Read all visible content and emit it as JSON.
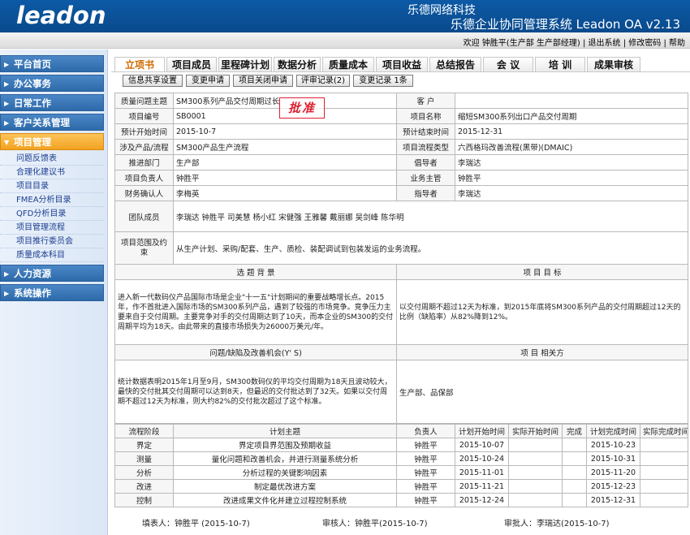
{
  "header": {
    "logo": "leadon",
    "company": "乐德网络科技",
    "system_title": "乐德企业协同管理系统 Leadon OA v2.13"
  },
  "userbar": {
    "welcome": "欢迎 钟胜平(生产部 生产部经理)",
    "logout": "退出系统",
    "change_password": "修改密码",
    "help": "帮助"
  },
  "sidebar": {
    "items": [
      {
        "label": "平台首页"
      },
      {
        "label": "办公事务"
      },
      {
        "label": "日常工作"
      },
      {
        "label": "客户关系管理"
      },
      {
        "label": "项目管理"
      },
      {
        "label": "人力资源"
      },
      {
        "label": "系统操作"
      }
    ],
    "subitems": [
      "问题反馈表",
      "合理化建议书",
      "项目目录",
      "FMEA分析目录",
      "QFD分析目录",
      "项目管理流程",
      "项目推行委员会",
      "质量成本科目"
    ]
  },
  "tabs": [
    "立项书",
    "项目成员",
    "里程碑计划",
    "数据分析",
    "质量成本",
    "项目收益",
    "总结报告",
    "会 议",
    "培 训",
    "成果审核"
  ],
  "subbuttons": [
    "信息共享设置",
    "变更申请",
    "项目关闭申请",
    "评审记录(2)",
    "变更记录 1条"
  ],
  "stamp": "批准",
  "form": {
    "l_topic": "质量问题主题",
    "topic": "SM300系列产品交付周期过长",
    "l_customer": "客 户",
    "customer": "",
    "l_code": "项目编号",
    "code": "SB0001",
    "l_name": "项目名称",
    "name": "缩短SM300系列出口产品交付周期",
    "l_start": "预计开始时间",
    "start": "2015-10-7",
    "l_end": "预计结束时间",
    "end": "2015-12-31",
    "l_product": "涉及产品/流程",
    "product": "SM300产品生产流程",
    "l_type": "项目流程类型",
    "type": "六西格玛改善流程(黑带)(DMAIC)",
    "l_dept": "推进部门",
    "dept": "生产部",
    "l_advocate": "倡导者",
    "advocate": "李瑞达",
    "l_leader": "项目负责人",
    "leader": "钟胜平",
    "l_supervisor": "业务主管",
    "supervisor": "钟胜平",
    "l_finance": "财务确认人",
    "finance": "李梅英",
    "l_mentor": "指导者",
    "mentor": "李瑞达",
    "l_members": "团队成员",
    "members": "李瑞达 钟胜平 司美慧 杨小红 宋健强 王雅馨 戴丽娜 吴剑峰 陈华明",
    "l_scope": "项目范围及约束",
    "scope": "从生产计划、采购/配套、生产、质检、装配调试到包装发运的业务流程。",
    "l_background": "选 题 背 景",
    "l_goal": "项 目 目 标",
    "background": "进入新一代数码仪产品国际市场是企业\"十一五\"计划期间的重要战略增长点。2015年，作不首批进入国际市场的SM300系列产品，遇到了较强的市场竞争。竞争压力主要来自于交付周期。主要竞争对手的交付周期达到了10天，而本企业的SM300的交付周期平均为18天。由此带来的直接市场损失为26000万美元/年。",
    "goal": "以交付周期不超过12天为标准，到2015年底将SM300系列产品的交付周期超过12天的比例（缺陷率）从82%降到12%。",
    "l_problem": "问题/缺陷及改善机会(Y' S)",
    "l_related": "项 目 相关方",
    "problem": "统计数据表明2015年1月至9月，SM300数码仪的平均交付周期为18天且波动较大，最快的交付批其交付周期可以达到8天，但最迟的交付批达到了32天。如果以交付周期不超过12天为标准，则大约82%的交付批次超过了这个标准。",
    "related": "生产部、品保部"
  },
  "plan": {
    "headers": [
      "流程阶段",
      "计划主题",
      "负责人",
      "计划开始时间",
      "实际开始时间",
      "完成",
      "计划完成时间",
      "实际完成时间"
    ],
    "rows": [
      {
        "phase": "界定",
        "topic": "界定项目界范围及预期收益",
        "owner": "钟胜平",
        "pstart": "2015-10-07",
        "astart": "",
        "done": "",
        "pend": "2015-10-23",
        "aend": ""
      },
      {
        "phase": "测量",
        "topic": "量化问题和改善机会，并进行测量系统分析",
        "owner": "钟胜平",
        "pstart": "2015-10-24",
        "astart": "",
        "done": "",
        "pend": "2015-10-31",
        "aend": ""
      },
      {
        "phase": "分析",
        "topic": "分析过程的关键影响因素",
        "owner": "钟胜平",
        "pstart": "2015-11-01",
        "astart": "",
        "done": "",
        "pend": "2015-11-20",
        "aend": ""
      },
      {
        "phase": "改进",
        "topic": "制定最优改进方案",
        "owner": "钟胜平",
        "pstart": "2015-11-21",
        "astart": "",
        "done": "",
        "pend": "2015-12-23",
        "aend": ""
      },
      {
        "phase": "控制",
        "topic": "改进成果文件化并建立过程控制系统",
        "owner": "钟胜平",
        "pstart": "2015-12-24",
        "astart": "",
        "done": "",
        "pend": "2015-12-31",
        "aend": ""
      }
    ]
  },
  "footer": {
    "filler": "填表人：钟胜平 (2015-10-7)",
    "reviewer": "审核人：钟胜平(2015-10-7)",
    "approver": "审批人：李瑞达(2015-10-7)"
  }
}
